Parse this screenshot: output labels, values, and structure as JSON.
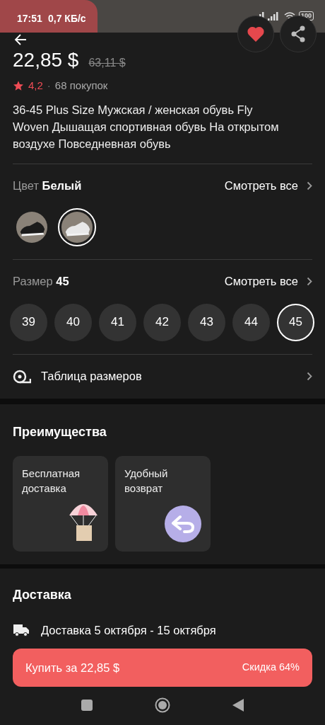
{
  "status_bar": {
    "time": "17:51",
    "speed": "0,7 КБ/с",
    "battery": "100"
  },
  "header": {
    "favorite": {
      "on": true
    }
  },
  "price": {
    "current": "22,85 $",
    "old": "63,11 $"
  },
  "rating": {
    "score": "4,2",
    "separator": "·",
    "purchases": "68 покупок"
  },
  "title": "36-45 Plus Size Мужская / женская обувь Fly Woven Дышащая спортивная обувь На открытом воздухе Повседневная обувь",
  "color": {
    "label": "Цвет",
    "value": "Белый",
    "see_all": "Смотреть все",
    "swatches": [
      {
        "color": "#1b1b1b",
        "selected": false
      },
      {
        "color": "#e8e8e8",
        "selected": true
      }
    ]
  },
  "size": {
    "label": "Размер",
    "value": "45",
    "see_all": "Смотреть все",
    "options": [
      {
        "label": "39",
        "selected": false
      },
      {
        "label": "40",
        "selected": false
      },
      {
        "label": "41",
        "selected": false
      },
      {
        "label": "42",
        "selected": false
      },
      {
        "label": "43",
        "selected": false
      },
      {
        "label": "44",
        "selected": false
      },
      {
        "label": "45",
        "selected": true
      }
    ]
  },
  "size_table": {
    "label": "Таблица размеров"
  },
  "benefits": {
    "title": "Преимущества",
    "items": [
      {
        "kind": "parachute",
        "text": "Бесплатная доставка"
      },
      {
        "kind": "return",
        "text": "Удобный возврат"
      }
    ]
  },
  "delivery": {
    "title": "Доставка",
    "text": "Доставка 5 октября - 15 октября"
  },
  "buy": {
    "label": "Купить за 22,85 $",
    "discount": "Скидка 64%"
  }
}
